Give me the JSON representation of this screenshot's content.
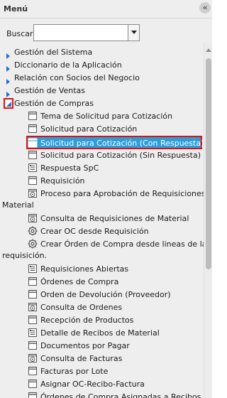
{
  "menu": {
    "title": "Menú",
    "collapse_glyph": "«",
    "collapse_icon": "double-chevron-left-icon"
  },
  "search": {
    "label": "Buscar:",
    "value": "",
    "placeholder": ""
  },
  "tree": {
    "top_level": [
      {
        "label": "Gestión del Sistema"
      },
      {
        "label": "Diccionario de la Aplicación"
      },
      {
        "label": "Relación con Socios del Negocio"
      },
      {
        "label": "Gestión de Ventas"
      }
    ],
    "open_node": {
      "label": "Gestión de Compras"
    },
    "children": [
      {
        "label": "Tema de Solicitud para Cotización",
        "icon": "window-icon"
      },
      {
        "label": "Solicitud para Cotización",
        "icon": "window-icon"
      },
      {
        "label": "Solicitud para Cotización (Con Respuesta)",
        "icon": "window-icon",
        "selected": true
      },
      {
        "label": "Solicitud para Cotización (Sin Respuesta)",
        "icon": "window-icon"
      },
      {
        "label": "Respuesta SpC",
        "icon": "report-icon"
      },
      {
        "label": "Requisición",
        "icon": "window-icon"
      },
      {
        "label": "Proceso para Aprobación de Requisiciones de",
        "wrap": "Material",
        "icon": "process-icon"
      },
      {
        "label": "Consulta de Requisiciones de Material",
        "icon": "process-icon"
      },
      {
        "label": "Crear OC desde Requisición",
        "icon": "gear-icon"
      },
      {
        "label": "Crear Órden de Compra desde lineas de la",
        "wrap": "requisición.",
        "icon": "gear-icon"
      },
      {
        "label": "Requisiciones Abiertas",
        "icon": "report-icon"
      },
      {
        "label": "Órdenes de Compra",
        "icon": "window-icon"
      },
      {
        "label": "Orden de Devolución (Proveedor)",
        "icon": "window-icon"
      },
      {
        "label": "Consulta de Ordenes",
        "icon": "process-icon"
      },
      {
        "label": "Recepción de Productos",
        "icon": "window-icon"
      },
      {
        "label": "Detalle de Recibos de Material",
        "icon": "report-icon"
      },
      {
        "label": "Documentos por Pagar",
        "icon": "window-icon"
      },
      {
        "label": "Consulta de Facturas",
        "icon": "process-icon"
      },
      {
        "label": "Facturas por Lote",
        "icon": "window-icon"
      },
      {
        "label": "Asignar OC-Recibo-Factura",
        "icon": "window-icon"
      },
      {
        "label": "Órdenes de Compra Asignadas a Recibos y",
        "icon": "window-icon"
      }
    ]
  },
  "colors": {
    "selection": "#2c9ed9",
    "highlight_border": "#e01010",
    "expander": "#1f6fd0",
    "panel": "#eeeeee"
  }
}
